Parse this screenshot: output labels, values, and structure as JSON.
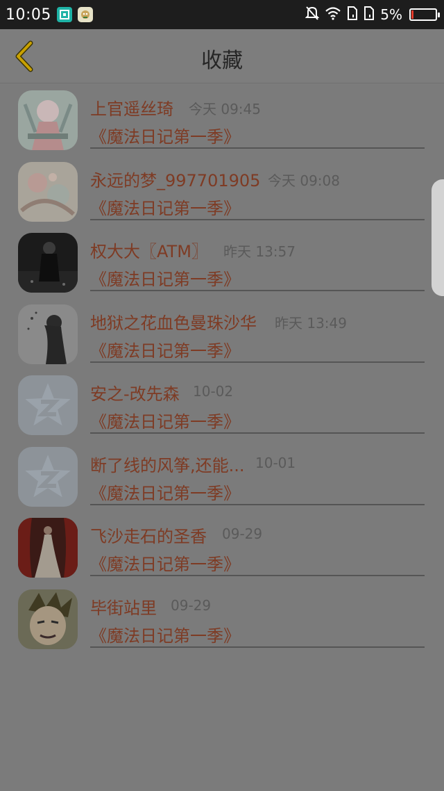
{
  "status_bar": {
    "time": "10:05",
    "battery_pct": "5%",
    "battery_level": 0.05,
    "icons": [
      "screenshot-app-icon",
      "robot-app-icon",
      "mute-icon",
      "wifi-icon",
      "sim-icon",
      "sim-icon",
      "battery-icon"
    ]
  },
  "header": {
    "title": "收藏",
    "back_icon": "chevron-left-icon"
  },
  "favorites": [
    {
      "name": "上官遥丝琦",
      "time": "今天 09:45",
      "book": "《魔法日记第一季》",
      "avatar": "anime-art"
    },
    {
      "name": "永远的梦_997701905",
      "time": "今天 09:08",
      "book": "《魔法日记第一季》",
      "avatar": "floral-art"
    },
    {
      "name": "权大大〖ATM〗",
      "time": "昨天 13:57",
      "book": "《魔法日记第一季》",
      "avatar": "dark-portrait"
    },
    {
      "name": "地狱之花血色曼珠沙华",
      "time": "昨天 13:49",
      "book": "《魔法日记第一季》",
      "avatar": "girl-silhouette"
    },
    {
      "name": "安之-改先森",
      "time": "10-02",
      "book": "《魔法日记第一季》",
      "avatar": "default-star"
    },
    {
      "name": "断了线的风筝,还能...",
      "time": "10-01",
      "book": "《魔法日记第一季》",
      "avatar": "default-star"
    },
    {
      "name": "飞沙走石的圣香",
      "time": "09-29",
      "book": "《魔法日记第一季》",
      "avatar": "curtain-portrait"
    },
    {
      "name": "毕街站里",
      "time": "09-29",
      "book": "《魔法日记第一季》",
      "avatar": "anime-man"
    }
  ],
  "colors": {
    "overlay_bg": "#7b7b7b",
    "accent_text": "#7e3b24",
    "back_icon": "#c9a100"
  }
}
